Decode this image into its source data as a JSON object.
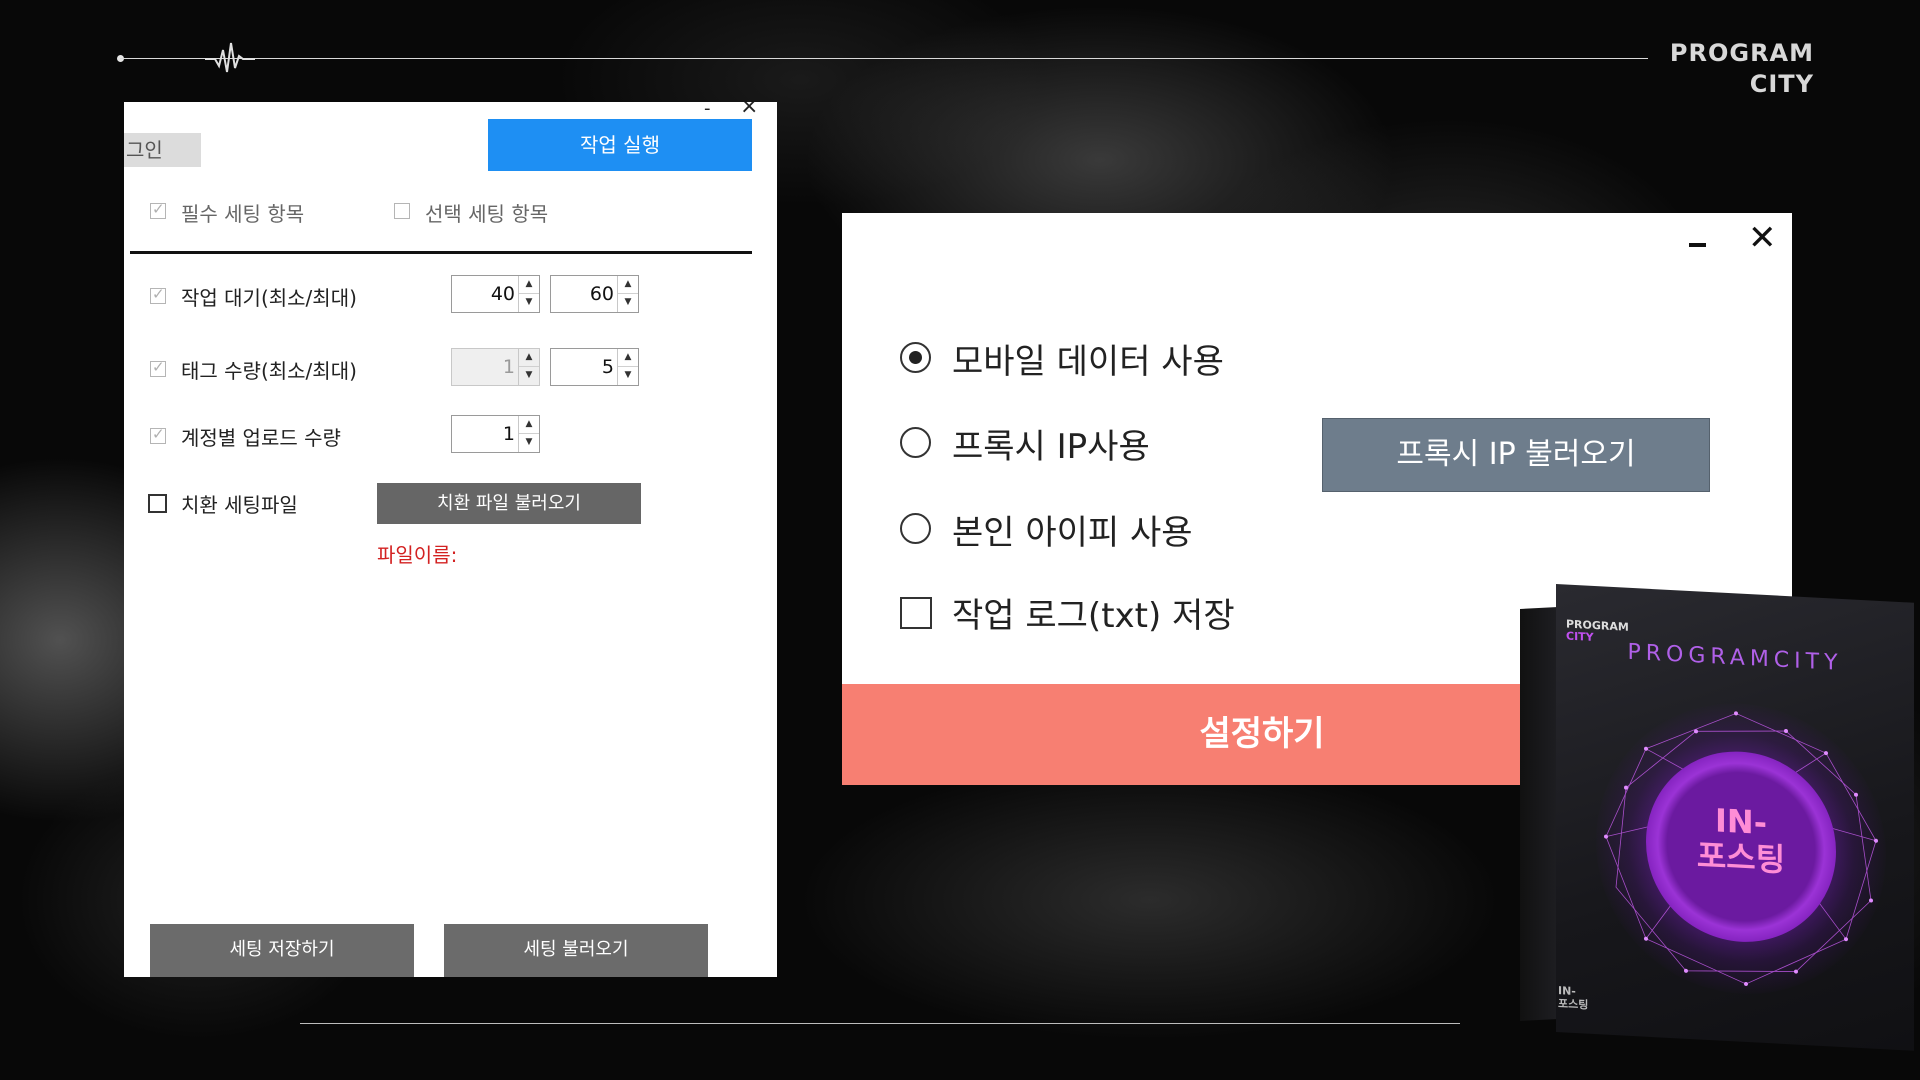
{
  "brand": {
    "line1": "PROGRAM",
    "line2": "CITY"
  },
  "left_panel": {
    "minimize": "-",
    "close": "×",
    "login_label": "그인",
    "run_label": "작업 실행",
    "required_settings": "필수 세팅 항목",
    "optional_settings": "선택 세팅 항목",
    "task_wait_label": "작업 대기(최소/최대)",
    "task_wait_min": "40",
    "task_wait_max": "60",
    "tag_count_label": "태그 수량(최소/최대)",
    "tag_count_min": "1",
    "tag_count_max": "5",
    "upload_label": "계정별 업로드 수량",
    "upload_value": "1",
    "replace_label": "치환 세팅파일",
    "load_replace_file": "치환 파일 불러오기",
    "filename_label": "파일이름:",
    "save_settings": "세팅 저장하기",
    "load_settings": "세팅 불러오기"
  },
  "right_panel": {
    "close": "✕",
    "mobile_data": "모바일 데이터 사용",
    "proxy_ip": "프록시 IP사용",
    "own_ip": "본인 아이피 사용",
    "save_log": "작업 로그(txt) 저장",
    "load_proxy": "프록시 IP 불러오기",
    "apply": "설정하기",
    "selected_option": "mobile_data"
  },
  "product_box": {
    "small_brand_1": "PROGRAM",
    "small_brand_2": "CITY",
    "title": "PROGRAMCITY",
    "name_1": "IN-",
    "name_2": "포스팅",
    "foot_1": "IN-",
    "foot_2": "포스팅"
  },
  "colors": {
    "run_button": "#1e8ff3",
    "apply_button": "#f77f72",
    "proxy_button": "#6e7d8c",
    "filename_red": "#d32222",
    "box_accent": "#b060e8"
  }
}
